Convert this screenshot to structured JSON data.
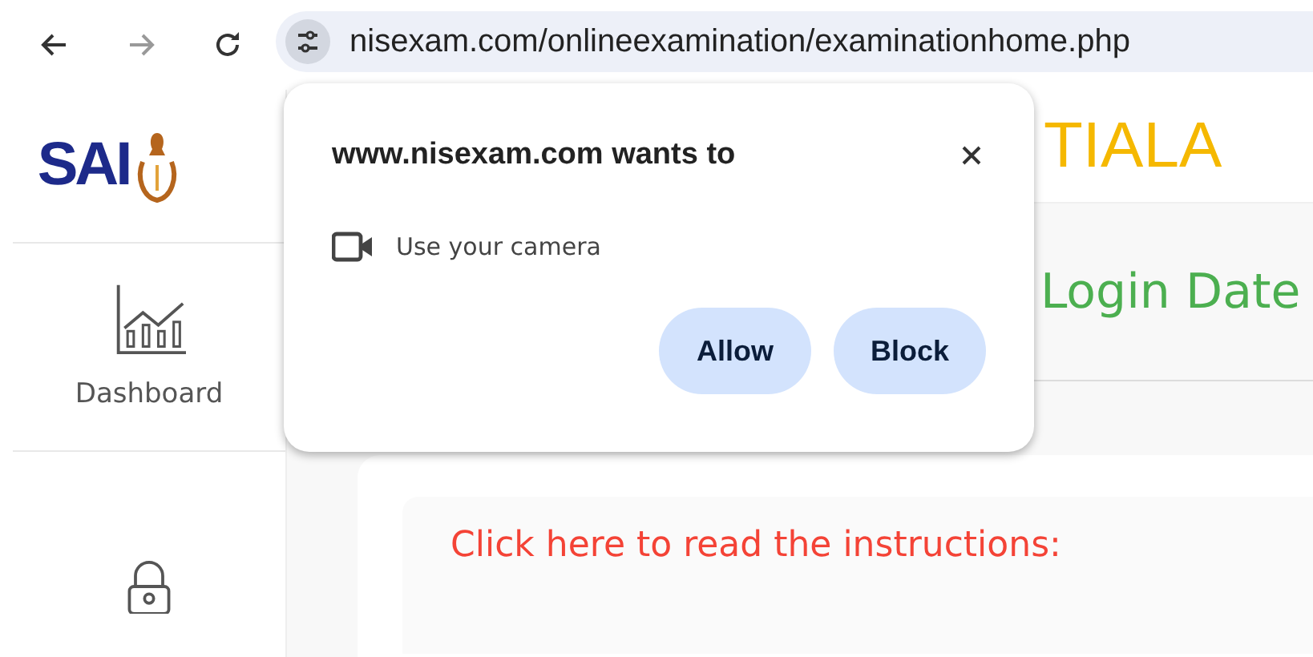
{
  "browser": {
    "url": "nisexam.com/onlineexamination/examinationhome.php"
  },
  "sidebar": {
    "logo_text": "SAI",
    "items": [
      {
        "kind": "dashboard",
        "label": "Dashboard"
      },
      {
        "kind": "lock"
      }
    ]
  },
  "header": {
    "title": "TIALA"
  },
  "main": {
    "login_label": "Login Date",
    "instructions_link": "Click here to read the instructions:"
  },
  "permission_popup": {
    "title": "www.nisexam.com wants to",
    "permission": "Use your camera",
    "buttons": [
      "Allow",
      "Block"
    ]
  }
}
